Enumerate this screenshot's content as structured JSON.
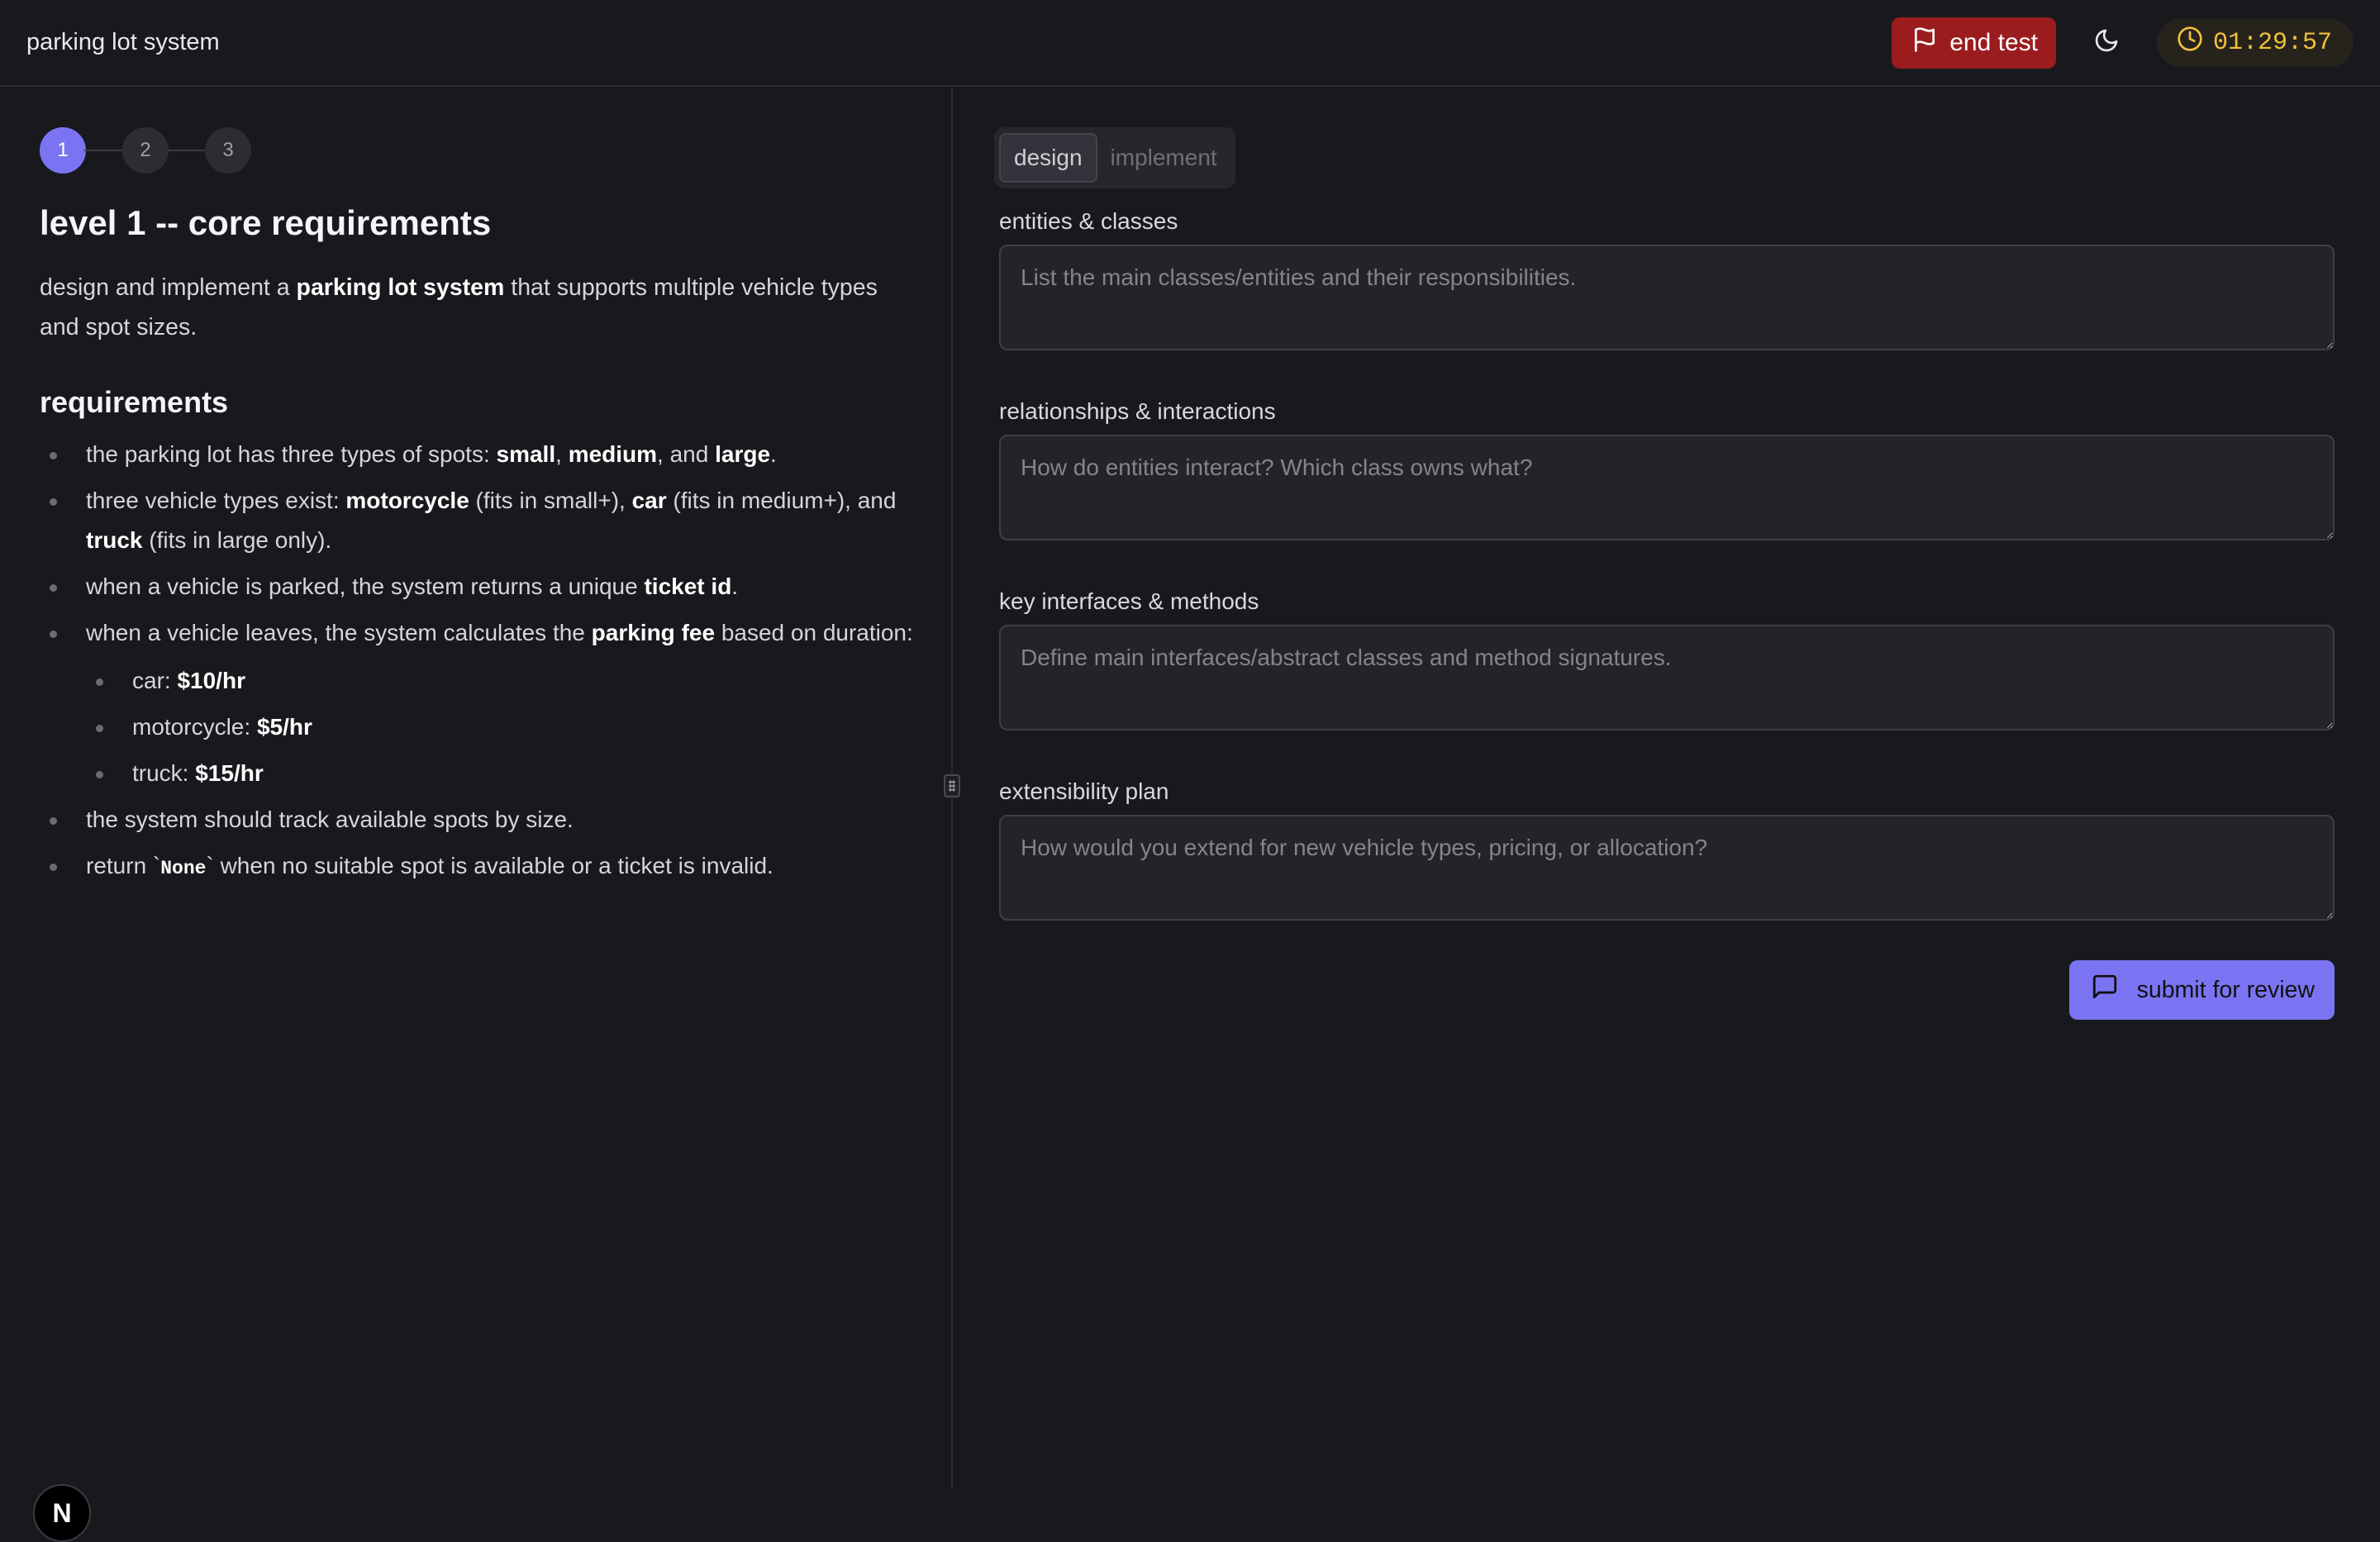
{
  "header": {
    "title": "parking lot system",
    "end_test_label": "end test",
    "theme_icon": "moon-icon",
    "timer": "01:29:57",
    "colors": {
      "end_test_bg": "#9b1c1f",
      "timer_text": "#f3c13a"
    }
  },
  "steps": [
    {
      "label": "1",
      "active": true
    },
    {
      "label": "2",
      "active": false
    },
    {
      "label": "3",
      "active": false
    }
  ],
  "problem": {
    "title": "level 1 -- core requirements",
    "intro_pre": "design and implement a ",
    "intro_bold": "parking lot system",
    "intro_post": " that supports multiple vehicle types and spot sizes.",
    "requirements_title": "requirements",
    "req1": {
      "t1": "the parking lot has three types of spots: ",
      "b1": "small",
      "t2": ", ",
      "b2": "medium",
      "t3": ", and ",
      "b3": "large",
      "t4": "."
    },
    "req2": {
      "t1": "three vehicle types exist: ",
      "b1": "motorcycle",
      "t2": " (fits in small+), ",
      "b2": "car",
      "t3": " (fits in medium+), and ",
      "b3": "truck",
      "t4": " (fits in large only)."
    },
    "req3": {
      "t1": "when a vehicle is parked, the system returns a unique ",
      "b1": "ticket id",
      "t2": "."
    },
    "req4": {
      "t1": "when a vehicle leaves, the system calculates the ",
      "b1": "parking fee",
      "t2": " based on duration:"
    },
    "fees": [
      {
        "label": "car: ",
        "value": "$10/hr"
      },
      {
        "label": "motorcycle: ",
        "value": "$5/hr"
      },
      {
        "label": "truck: ",
        "value": "$15/hr"
      }
    ],
    "req5": "the system should track available spots by size.",
    "req6": {
      "t1": "return `",
      "code": "None",
      "t2": "` when no suitable spot is available or a ticket is invalid."
    }
  },
  "tabs": [
    {
      "label": "design",
      "active": true
    },
    {
      "label": "implement",
      "active": false
    }
  ],
  "fields": [
    {
      "label": "entities & classes",
      "placeholder": "List the main classes/entities and their responsibilities.",
      "value": ""
    },
    {
      "label": "relationships & interactions",
      "placeholder": "How do entities interact? Which class owns what?",
      "value": ""
    },
    {
      "label": "key interfaces & methods",
      "placeholder": "Define main interfaces/abstract classes and method signatures.",
      "value": ""
    },
    {
      "label": "extensibility plan",
      "placeholder": "How would you extend for new vehicle types, pricing, or allocation?",
      "value": ""
    }
  ],
  "submit_label": "submit for review",
  "logo_letter": "N",
  "accent_color": "#7b74f2"
}
